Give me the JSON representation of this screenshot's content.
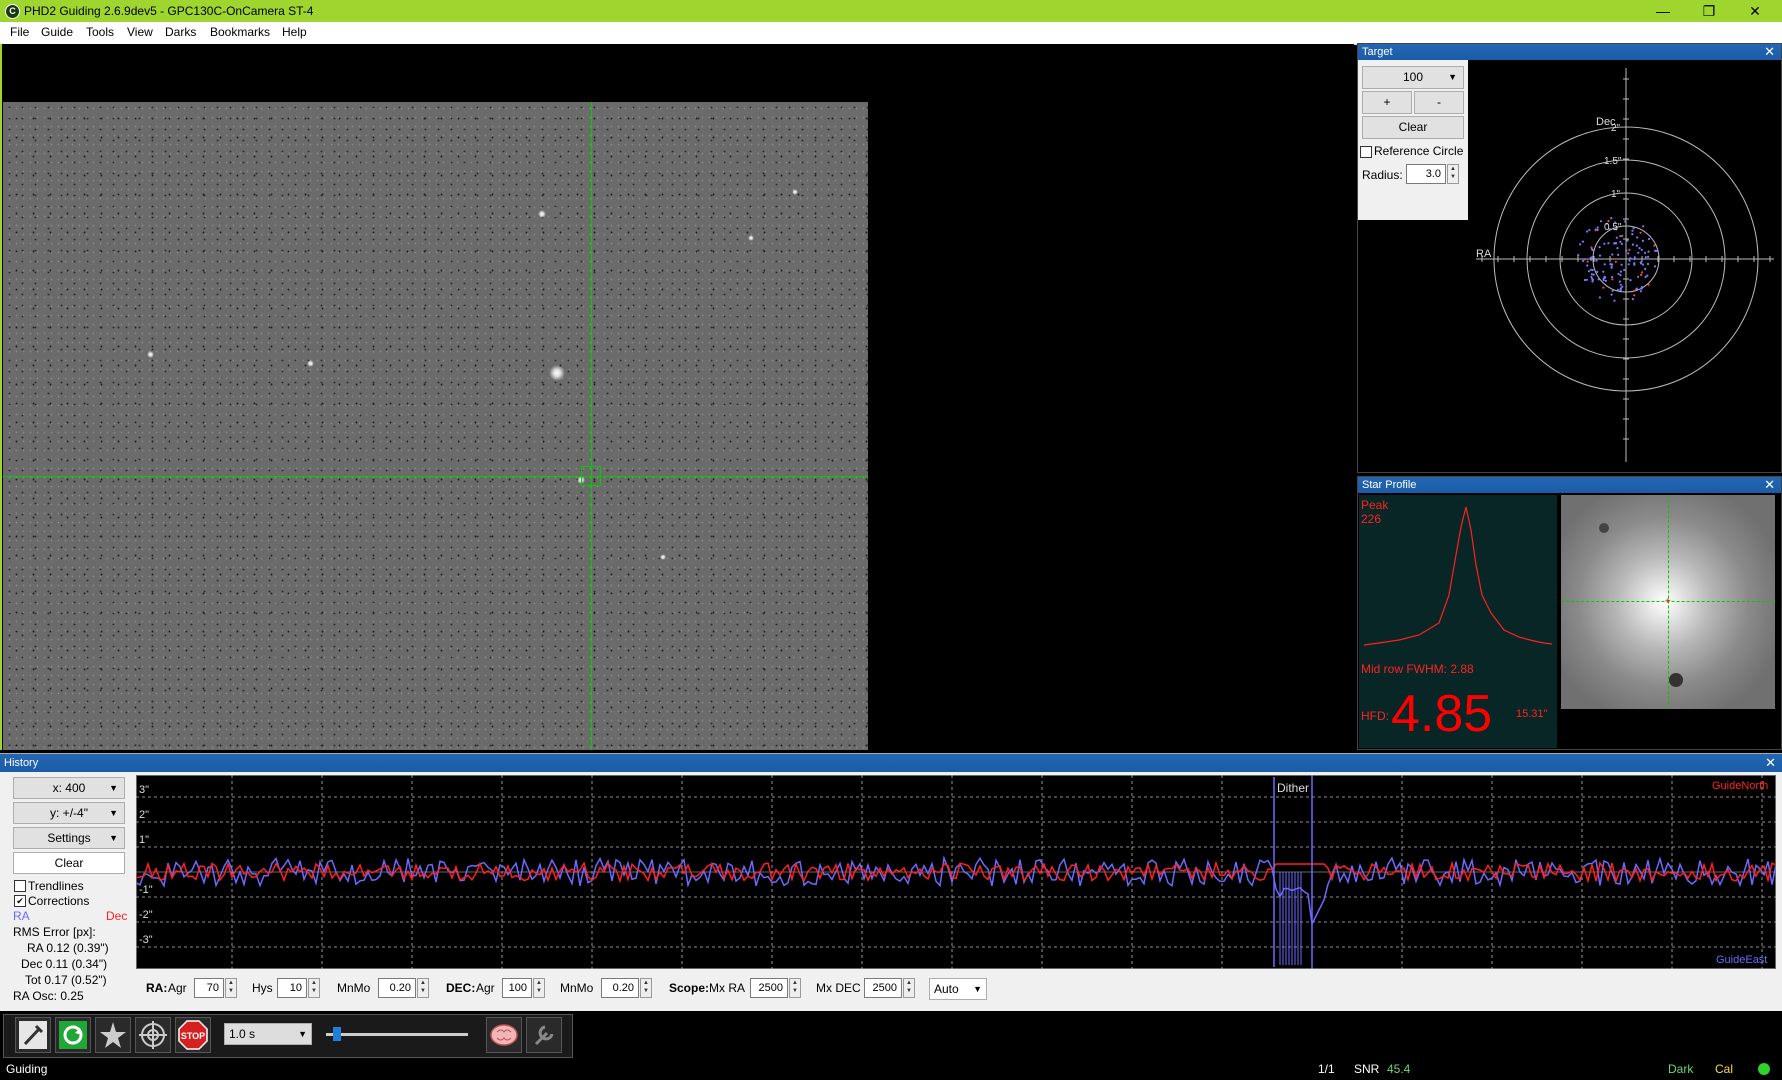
{
  "window": {
    "title": "PHD2 Guiding 2.6.9dev5 - GPC130C-OnCamera ST-4",
    "app_icon": "phd2-icon",
    "minimize": "—",
    "maximize": "❐",
    "close": "✕"
  },
  "menu": [
    "File",
    "Guide",
    "Tools",
    "View",
    "Darks",
    "Bookmarks",
    "Help"
  ],
  "target": {
    "title": "Target",
    "zoom_value": "100",
    "plus": "+",
    "minus": "-",
    "clear": "Clear",
    "reference_circle_label": "Reference Circle",
    "reference_circle_checked": false,
    "radius_label": "Radius:",
    "radius_value": "3.0",
    "axis_dec": "Dec",
    "axis_ra": "RA",
    "ring_labels": [
      "2\"",
      "1.5\"",
      "1\"",
      "0.5\""
    ]
  },
  "star_profile": {
    "title": "Star Profile",
    "peak_label": "Peak",
    "peak_value": "226",
    "fwhm_text": "Mid row FWHM: 2.88",
    "hfd_label": "HFD:",
    "hfd_value": "4.85",
    "hfd_arcsec": "15.31\""
  },
  "history": {
    "title": "History",
    "x_scale": "x: 400",
    "y_scale": "y: +/-4\"",
    "settings": "Settings",
    "clear": "Clear",
    "trendlines_label": "Trendlines",
    "trendlines_checked": false,
    "corrections_label": "Corrections",
    "corrections_checked": true,
    "ra_label": "RA",
    "dec_label": "Dec",
    "rms_title": "RMS Error [px]:",
    "rms_ra": "RA  0.12 (0.39\")",
    "rms_dec": "Dec  0.11 (0.34\")",
    "rms_tot": "Tot  0.17 (0.52\")",
    "ra_osc": "RA Osc: 0.25",
    "y_labels": [
      "3\"",
      "2\"",
      "1\"",
      "-1\"",
      "-2\"",
      "-3\""
    ],
    "dither_label": "Dither",
    "guide_north": "GuideNorth",
    "guide_east": "GuideEast",
    "colors": {
      "ra": "#6a6aff",
      "dec": "#ff2020"
    }
  },
  "params": {
    "ra_label": "RA:",
    "agr_label": "Agr",
    "ra_agr": "70",
    "hys_label": "Hys",
    "ra_hys": "10",
    "mnmo_label": "MnMo",
    "ra_mnmo": "0.20",
    "dec_label": "DEC:",
    "dec_agr": "100",
    "dec_mnmo": "0.20",
    "scope_label": "Scope:",
    "mx_ra_label": "Mx RA",
    "mx_ra": "2500",
    "mx_dec_label": "Mx DEC",
    "mx_dec": "2500",
    "dec_mode": "Auto"
  },
  "toolbar": {
    "exposure": "1.0 s",
    "stop": "STOP",
    "exposure_gain_fraction": 0.05
  },
  "status": {
    "state": "Guiding",
    "frames": "1/1",
    "snr_label": "SNR",
    "snr_value": "45.4",
    "dark": "Dark",
    "cal": "Cal"
  }
}
